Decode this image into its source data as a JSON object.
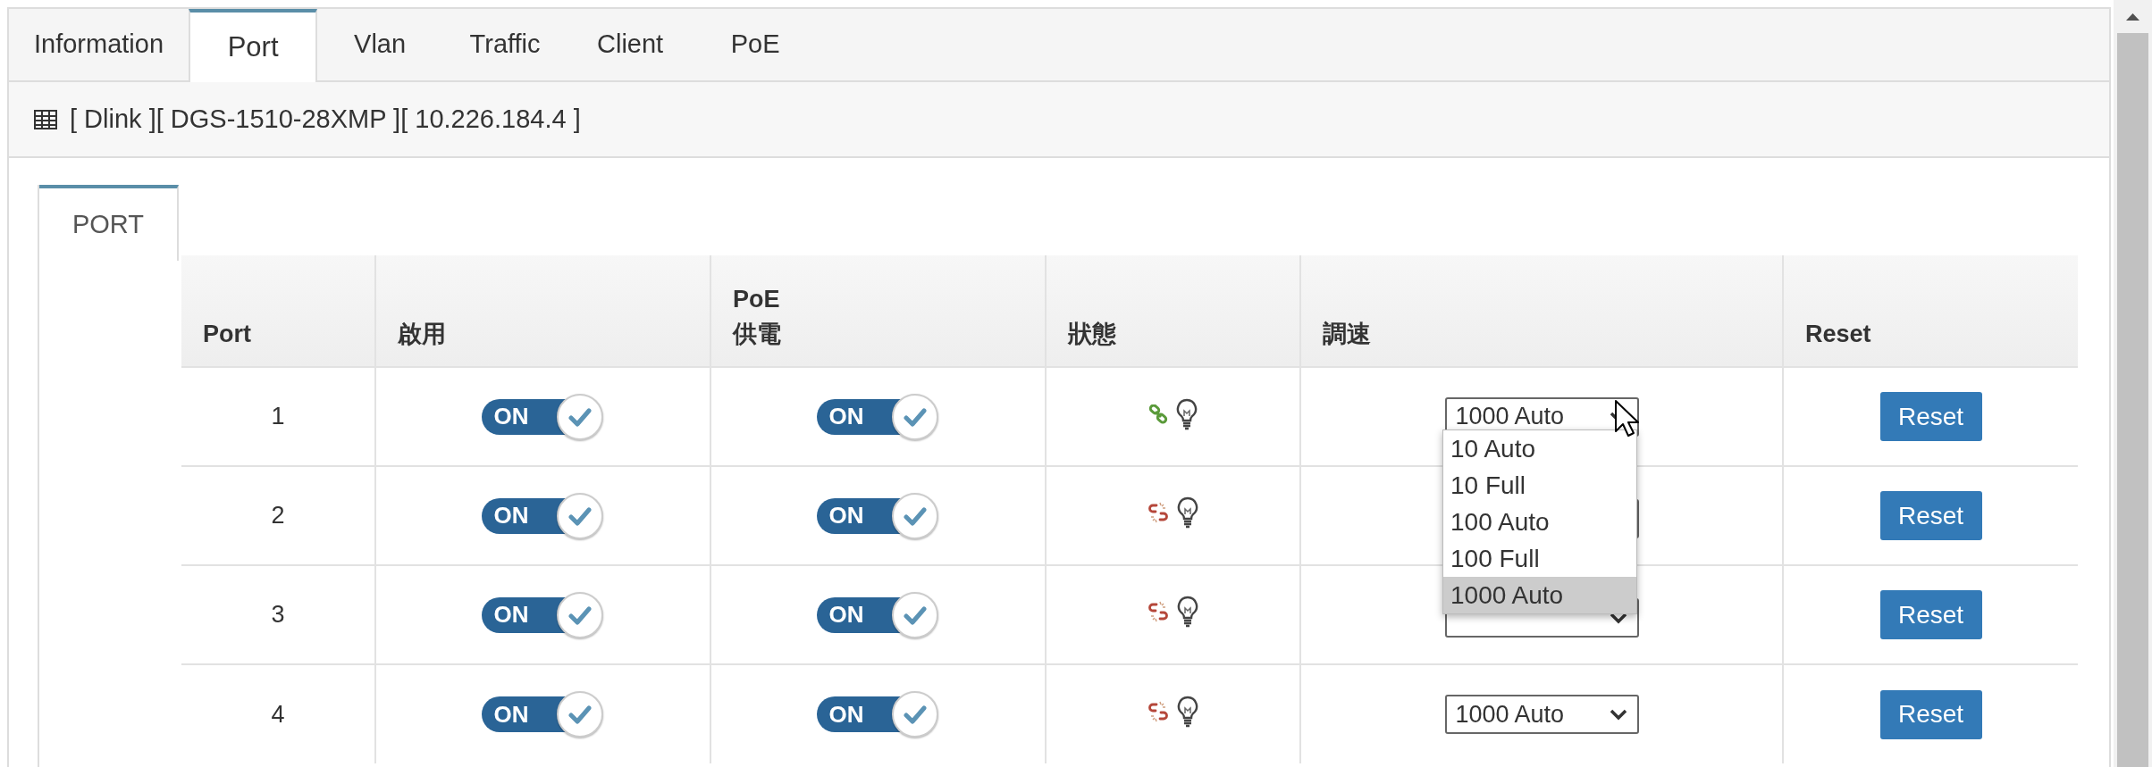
{
  "tabs": [
    {
      "label": "Information",
      "selected": false
    },
    {
      "label": "Port",
      "selected": true
    },
    {
      "label": "Vlan",
      "selected": false
    },
    {
      "label": "Traffic",
      "selected": false
    },
    {
      "label": "Client",
      "selected": false
    },
    {
      "label": "PoE",
      "selected": false
    }
  ],
  "device_header": {
    "text": "[ Dlink ][ DGS-1510-28XMP ][ 10.226.184.4 ]"
  },
  "section_tabs": [
    {
      "label": "PORT",
      "selected": true
    }
  ],
  "table": {
    "columns": [
      "Port",
      "啟用",
      "PoE\n供電",
      "狀態",
      "調速",
      "Reset"
    ],
    "rows": [
      {
        "port": "1",
        "enabled": {
          "label": "ON",
          "on": true
        },
        "poe": {
          "label": "ON",
          "on": true
        },
        "linked": true,
        "speed": "1000 Auto",
        "speed_menu": {
          "options": [
            {
              "label": "10 Auto",
              "selected": false
            },
            {
              "label": "10 Full",
              "selected": false
            },
            {
              "label": "100 Auto",
              "selected": false
            },
            {
              "label": "100 Full",
              "selected": false
            },
            {
              "label": "1000 Auto",
              "selected": true
            }
          ]
        },
        "reset": "Reset"
      },
      {
        "port": "2",
        "enabled": {
          "label": "ON",
          "on": true
        },
        "poe": {
          "label": "ON",
          "on": true
        },
        "linked": false,
        "reset": "Reset"
      },
      {
        "port": "3",
        "enabled": {
          "label": "ON",
          "on": true
        },
        "poe": {
          "label": "ON",
          "on": true
        },
        "linked": false,
        "reset": "Reset"
      },
      {
        "port": "4",
        "enabled": {
          "label": "ON",
          "on": true
        },
        "poe": {
          "label": "ON",
          "on": true
        },
        "linked": false,
        "speed": "1000 Auto",
        "reset": "Reset"
      }
    ]
  }
}
